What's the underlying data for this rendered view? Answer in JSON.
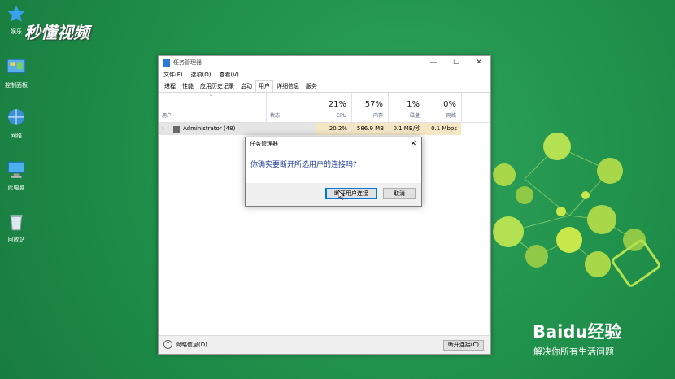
{
  "desktop": {
    "icons": [
      {
        "label": "娱乐",
        "icon": "star-icon"
      },
      {
        "label": "控制面板",
        "icon": "control-panel-icon"
      },
      {
        "label": "网络",
        "icon": "network-icon"
      },
      {
        "label": "此电脑",
        "icon": "computer-icon"
      },
      {
        "label": "回收站",
        "icon": "recycle-bin-icon"
      }
    ],
    "watermark_top": "秒懂视频",
    "watermark_baidu": "Baidu经验",
    "watermark_slogan": "解决你所有生活问题"
  },
  "window": {
    "title": "任务管理器",
    "menu": [
      "文件(F)",
      "选项(O)",
      "查看(V)"
    ],
    "tabs": [
      "进程",
      "性能",
      "应用历史记录",
      "启动",
      "用户",
      "详细信息",
      "服务"
    ],
    "active_tab": "用户",
    "columns": {
      "user": "用户",
      "status": "状态",
      "cpu": {
        "pct": "21%",
        "label": "CPU"
      },
      "mem": {
        "pct": "57%",
        "label": "内存"
      },
      "disk": {
        "pct": "1%",
        "label": "磁盘"
      },
      "net": {
        "pct": "0%",
        "label": "网络"
      }
    },
    "rows": [
      {
        "name": "Administrator (48)",
        "cpu": "20.2%",
        "mem": "586.9 MB",
        "disk": "0.1 MB/秒",
        "net": "0.1 Mbps"
      }
    ],
    "footer": {
      "fewer": "简略信息(D)",
      "disconnect": "断开连接(C)"
    }
  },
  "dialog": {
    "title": "任务管理器",
    "message": "你确实要断开所选用户的连接吗?",
    "ok": "断开用户连接",
    "cancel": "取消"
  }
}
